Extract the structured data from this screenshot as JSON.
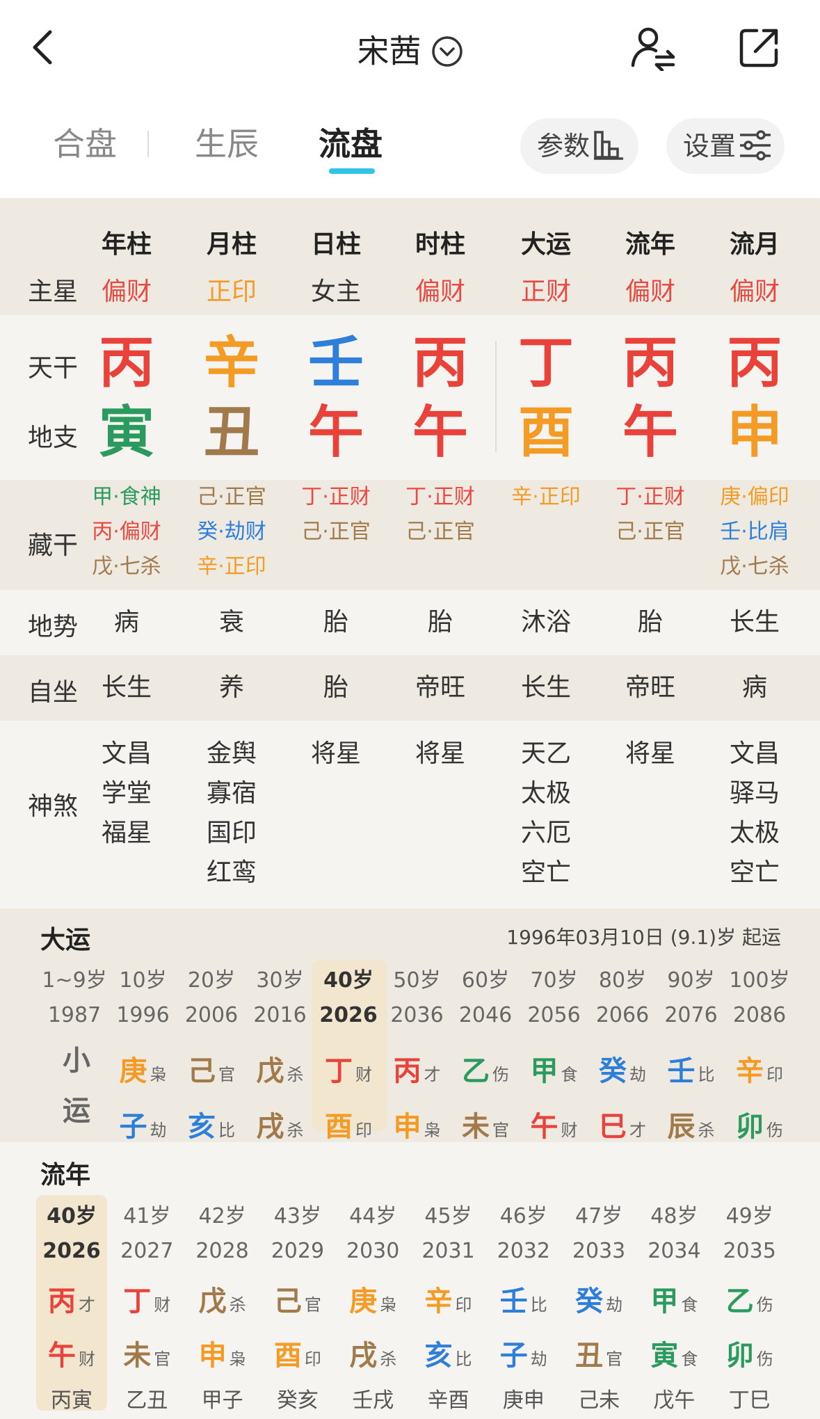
{
  "header": {
    "title": "宋茜"
  },
  "tabs": [
    "合盘",
    "生辰",
    "流盘"
  ],
  "buttons": {
    "params": "参数",
    "settings": "设置"
  },
  "columns": [
    "年柱",
    "月柱",
    "日柱",
    "时柱",
    "大运",
    "流年",
    "流月"
  ],
  "labels": {
    "main_star": "主星",
    "tiangan": "天干",
    "dizhi": "地支",
    "canggan": "藏干",
    "dishi": "地势",
    "zizuo": "自坐",
    "shensha": "神煞"
  },
  "main_star": [
    {
      "t": "偏财",
      "c": "#e84a42"
    },
    {
      "t": "正印",
      "c": "#f39b24"
    },
    {
      "t": "女主",
      "c": "#333333"
    },
    {
      "t": "偏财",
      "c": "#e84a42"
    },
    {
      "t": "正财",
      "c": "#e84a42"
    },
    {
      "t": "偏财",
      "c": "#e84a42"
    },
    {
      "t": "偏财",
      "c": "#e84a42"
    }
  ],
  "tiangan": [
    {
      "t": "丙",
      "c": "#e8423a"
    },
    {
      "t": "辛",
      "c": "#f39b24"
    },
    {
      "t": "壬",
      "c": "#2e7fd9"
    },
    {
      "t": "丙",
      "c": "#e8423a"
    },
    {
      "t": "丁",
      "c": "#e8423a"
    },
    {
      "t": "丙",
      "c": "#e8423a"
    },
    {
      "t": "丙",
      "c": "#e8423a"
    }
  ],
  "dizhi": [
    {
      "t": "寅",
      "c": "#2a9a5e"
    },
    {
      "t": "丑",
      "c": "#a07a4a"
    },
    {
      "t": "午",
      "c": "#e8423a"
    },
    {
      "t": "午",
      "c": "#e8423a"
    },
    {
      "t": "酉",
      "c": "#f39b24"
    },
    {
      "t": "午",
      "c": "#e8423a"
    },
    {
      "t": "申",
      "c": "#f39b24"
    }
  ],
  "canggan": [
    [
      {
        "t": "甲·食神",
        "c": "#2a9a5e"
      },
      {
        "t": "丙·偏财",
        "c": "#e84a42"
      },
      {
        "t": "戊·七杀",
        "c": "#a07a4a"
      }
    ],
    [
      {
        "t": "己·正官",
        "c": "#a07a4a"
      },
      {
        "t": "癸·劫财",
        "c": "#2e7fd9"
      },
      {
        "t": "辛·正印",
        "c": "#f39b24"
      }
    ],
    [
      {
        "t": "丁·正财",
        "c": "#e84a42"
      },
      {
        "t": "己·正官",
        "c": "#a07a4a"
      }
    ],
    [
      {
        "t": "丁·正财",
        "c": "#e84a42"
      },
      {
        "t": "己·正官",
        "c": "#a07a4a"
      }
    ],
    [
      {
        "t": "辛·正印",
        "c": "#f39b24"
      }
    ],
    [
      {
        "t": "丁·正财",
        "c": "#e84a42"
      },
      {
        "t": "己·正官",
        "c": "#a07a4a"
      }
    ],
    [
      {
        "t": "庚·偏印",
        "c": "#f39b24"
      },
      {
        "t": "壬·比肩",
        "c": "#2e7fd9"
      },
      {
        "t": "戊·七杀",
        "c": "#a07a4a"
      }
    ]
  ],
  "dishi": [
    "病",
    "衰",
    "胎",
    "胎",
    "沐浴",
    "胎",
    "长生"
  ],
  "zizuo": [
    "长生",
    "养",
    "胎",
    "帝旺",
    "长生",
    "帝旺",
    "病"
  ],
  "shensha": [
    [
      "文昌",
      "学堂",
      "福星"
    ],
    [
      "金舆",
      "寡宿",
      "国印",
      "红鸾"
    ],
    [
      "将星"
    ],
    [
      "将星"
    ],
    [
      "天乙",
      "太极",
      "六厄",
      "空亡"
    ],
    [
      "将星"
    ],
    [
      "文昌",
      "驿马",
      "太极",
      "空亡"
    ]
  ],
  "dayun": {
    "title": "大运",
    "start_info": "1996年03月10日 (9.1)岁 起运",
    "xiaoyun_label": [
      "小",
      "运"
    ],
    "items": [
      {
        "age": "1~9岁",
        "year": "1987"
      },
      {
        "age": "10岁",
        "year": "1996",
        "g": "庚",
        "gc": "#f39b24",
        "gt": "枭",
        "z": "子",
        "zc": "#2e7fd9",
        "zt": "劫"
      },
      {
        "age": "20岁",
        "year": "2006",
        "g": "己",
        "gc": "#a07a4a",
        "gt": "官",
        "z": "亥",
        "zc": "#2e7fd9",
        "zt": "比"
      },
      {
        "age": "30岁",
        "year": "2016",
        "g": "戊",
        "gc": "#a07a4a",
        "gt": "杀",
        "z": "戌",
        "zc": "#a07a4a",
        "zt": "杀"
      },
      {
        "age": "40岁",
        "year": "2026",
        "g": "丁",
        "gc": "#e8423a",
        "gt": "财",
        "z": "酉",
        "zc": "#f39b24",
        "zt": "印",
        "hl": true
      },
      {
        "age": "50岁",
        "year": "2036",
        "g": "丙",
        "gc": "#e8423a",
        "gt": "才",
        "z": "申",
        "zc": "#f39b24",
        "zt": "枭"
      },
      {
        "age": "60岁",
        "year": "2046",
        "g": "乙",
        "gc": "#2a9a5e",
        "gt": "伤",
        "z": "未",
        "zc": "#a07a4a",
        "zt": "官"
      },
      {
        "age": "70岁",
        "year": "2056",
        "g": "甲",
        "gc": "#2a9a5e",
        "gt": "食",
        "z": "午",
        "zc": "#e8423a",
        "zt": "财"
      },
      {
        "age": "80岁",
        "year": "2066",
        "g": "癸",
        "gc": "#2e7fd9",
        "gt": "劫",
        "z": "巳",
        "zc": "#e8423a",
        "zt": "才"
      },
      {
        "age": "90岁",
        "year": "2076",
        "g": "壬",
        "gc": "#2e7fd9",
        "gt": "比",
        "z": "辰",
        "zc": "#a07a4a",
        "zt": "杀"
      },
      {
        "age": "100岁",
        "year": "2086",
        "g": "辛",
        "gc": "#f39b24",
        "gt": "印",
        "z": "卯",
        "zc": "#2a9a5e",
        "zt": "伤"
      }
    ]
  },
  "liunian": {
    "title": "流年",
    "items": [
      {
        "age": "40岁",
        "year": "2026",
        "g": "丙",
        "gc": "#e8423a",
        "gt": "才",
        "z": "午",
        "zc": "#e8423a",
        "zt": "财",
        "xy": "丙寅",
        "hl": true
      },
      {
        "age": "41岁",
        "year": "2027",
        "g": "丁",
        "gc": "#e8423a",
        "gt": "财",
        "z": "未",
        "zc": "#a07a4a",
        "zt": "官",
        "xy": "乙丑"
      },
      {
        "age": "42岁",
        "year": "2028",
        "g": "戊",
        "gc": "#a07a4a",
        "gt": "杀",
        "z": "申",
        "zc": "#f39b24",
        "zt": "枭",
        "xy": "甲子"
      },
      {
        "age": "43岁",
        "year": "2029",
        "g": "己",
        "gc": "#a07a4a",
        "gt": "官",
        "z": "酉",
        "zc": "#f39b24",
        "zt": "印",
        "xy": "癸亥"
      },
      {
        "age": "44岁",
        "year": "2030",
        "g": "庚",
        "gc": "#f39b24",
        "gt": "枭",
        "z": "戌",
        "zc": "#a07a4a",
        "zt": "杀",
        "xy": "壬戌"
      },
      {
        "age": "45岁",
        "year": "2031",
        "g": "辛",
        "gc": "#f39b24",
        "gt": "印",
        "z": "亥",
        "zc": "#2e7fd9",
        "zt": "比",
        "xy": "辛酉"
      },
      {
        "age": "46岁",
        "year": "2032",
        "g": "壬",
        "gc": "#2e7fd9",
        "gt": "比",
        "z": "子",
        "zc": "#2e7fd9",
        "zt": "劫",
        "xy": "庚申"
      },
      {
        "age": "47岁",
        "year": "2033",
        "g": "癸",
        "gc": "#2e7fd9",
        "gt": "劫",
        "z": "丑",
        "zc": "#a07a4a",
        "zt": "官",
        "xy": "己未"
      },
      {
        "age": "48岁",
        "year": "2034",
        "g": "甲",
        "gc": "#2a9a5e",
        "gt": "食",
        "z": "寅",
        "zc": "#2a9a5e",
        "zt": "食",
        "xy": "戊午"
      },
      {
        "age": "49岁",
        "year": "2035",
        "g": "乙",
        "gc": "#2a9a5e",
        "gt": "伤",
        "z": "卯",
        "zc": "#2a9a5e",
        "zt": "伤",
        "xy": "丁巳"
      }
    ]
  }
}
